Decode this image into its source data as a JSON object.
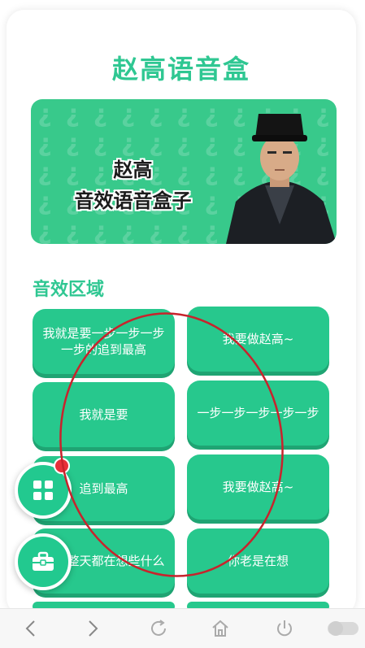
{
  "app": {
    "title": "赵高语音盒"
  },
  "banner": {
    "line1": "赵高",
    "line2": "音效语音盒子",
    "pattern_glyph": "¿"
  },
  "section": {
    "title": "音效区域"
  },
  "sounds": [
    {
      "label": "我就是要一步一步一步一步的追到最高"
    },
    {
      "label": "我要做赵高~"
    },
    {
      "label": "我就是要"
    },
    {
      "label": "一步一步一步一步一步"
    },
    {
      "label": "追到最高"
    },
    {
      "label": "我要做赵高~"
    },
    {
      "label": "现在整天都在想些什么"
    },
    {
      "label": "你老是在想"
    }
  ],
  "fabs": {
    "grid_icon": "grid-icon",
    "toolbox_icon": "toolbox-icon"
  },
  "navbar": {
    "items": [
      "back-icon",
      "forward-icon",
      "refresh-icon",
      "home-icon",
      "power-icon",
      "toggle-icon"
    ]
  },
  "colors": {
    "primary": "#2fc792",
    "button": "#27c88d",
    "annotation": "#c8232c"
  }
}
